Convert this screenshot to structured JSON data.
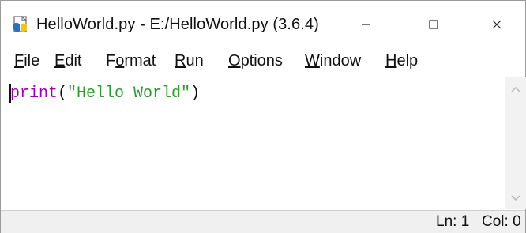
{
  "window": {
    "title": "HelloWorld.py - E:/HelloWorld.py (3.6.4)",
    "controls": {
      "minimize": "–",
      "maximize": "□",
      "close": "×"
    }
  },
  "menubar": {
    "items": [
      {
        "label": "File",
        "mnemonic": "F",
        "rest": "ile"
      },
      {
        "label": "Edit",
        "mnemonic": "E",
        "rest": "dit"
      },
      {
        "label": "Format",
        "prefix": "F",
        "mnemonic": "o",
        "rest": "rmat"
      },
      {
        "label": "Run",
        "mnemonic": "R",
        "rest": "un"
      },
      {
        "label": "Options",
        "mnemonic": "O",
        "rest": "ptions"
      },
      {
        "label": "Window",
        "mnemonic": "W",
        "rest": "indow"
      },
      {
        "label": "Help",
        "mnemonic": "H",
        "rest": "elp"
      }
    ]
  },
  "editor": {
    "lines": [
      {
        "tokens": {
          "builtin": "print",
          "open": "(",
          "string": "\"Hello World\"",
          "close": ")"
        }
      }
    ]
  },
  "statusbar": {
    "line": "Ln: 1",
    "column": "Col: 0"
  },
  "colors": {
    "builtin": "#9a00b0",
    "string": "#2d9a2d",
    "statusbar_bg": "#f0f0f0"
  },
  "icons": {
    "app": "python-idle-file-icon",
    "scroll_up": "chevron-up-icon",
    "scroll_down": "chevron-down-icon"
  }
}
